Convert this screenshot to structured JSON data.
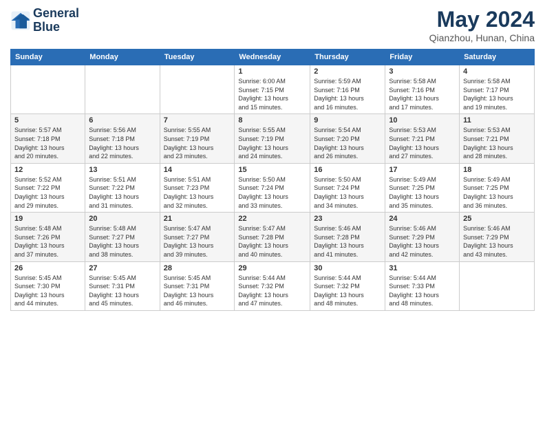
{
  "logo": {
    "line1": "General",
    "line2": "Blue"
  },
  "title": {
    "month_year": "May 2024",
    "location": "Qianzhou, Hunan, China"
  },
  "days_of_week": [
    "Sunday",
    "Monday",
    "Tuesday",
    "Wednesday",
    "Thursday",
    "Friday",
    "Saturday"
  ],
  "weeks": [
    [
      {
        "day": "",
        "info": ""
      },
      {
        "day": "",
        "info": ""
      },
      {
        "day": "",
        "info": ""
      },
      {
        "day": "1",
        "info": "Sunrise: 6:00 AM\nSunset: 7:15 PM\nDaylight: 13 hours\nand 15 minutes."
      },
      {
        "day": "2",
        "info": "Sunrise: 5:59 AM\nSunset: 7:16 PM\nDaylight: 13 hours\nand 16 minutes."
      },
      {
        "day": "3",
        "info": "Sunrise: 5:58 AM\nSunset: 7:16 PM\nDaylight: 13 hours\nand 17 minutes."
      },
      {
        "day": "4",
        "info": "Sunrise: 5:58 AM\nSunset: 7:17 PM\nDaylight: 13 hours\nand 19 minutes."
      }
    ],
    [
      {
        "day": "5",
        "info": "Sunrise: 5:57 AM\nSunset: 7:18 PM\nDaylight: 13 hours\nand 20 minutes."
      },
      {
        "day": "6",
        "info": "Sunrise: 5:56 AM\nSunset: 7:18 PM\nDaylight: 13 hours\nand 22 minutes."
      },
      {
        "day": "7",
        "info": "Sunrise: 5:55 AM\nSunset: 7:19 PM\nDaylight: 13 hours\nand 23 minutes."
      },
      {
        "day": "8",
        "info": "Sunrise: 5:55 AM\nSunset: 7:19 PM\nDaylight: 13 hours\nand 24 minutes."
      },
      {
        "day": "9",
        "info": "Sunrise: 5:54 AM\nSunset: 7:20 PM\nDaylight: 13 hours\nand 26 minutes."
      },
      {
        "day": "10",
        "info": "Sunrise: 5:53 AM\nSunset: 7:21 PM\nDaylight: 13 hours\nand 27 minutes."
      },
      {
        "day": "11",
        "info": "Sunrise: 5:53 AM\nSunset: 7:21 PM\nDaylight: 13 hours\nand 28 minutes."
      }
    ],
    [
      {
        "day": "12",
        "info": "Sunrise: 5:52 AM\nSunset: 7:22 PM\nDaylight: 13 hours\nand 29 minutes."
      },
      {
        "day": "13",
        "info": "Sunrise: 5:51 AM\nSunset: 7:22 PM\nDaylight: 13 hours\nand 31 minutes."
      },
      {
        "day": "14",
        "info": "Sunrise: 5:51 AM\nSunset: 7:23 PM\nDaylight: 13 hours\nand 32 minutes."
      },
      {
        "day": "15",
        "info": "Sunrise: 5:50 AM\nSunset: 7:24 PM\nDaylight: 13 hours\nand 33 minutes."
      },
      {
        "day": "16",
        "info": "Sunrise: 5:50 AM\nSunset: 7:24 PM\nDaylight: 13 hours\nand 34 minutes."
      },
      {
        "day": "17",
        "info": "Sunrise: 5:49 AM\nSunset: 7:25 PM\nDaylight: 13 hours\nand 35 minutes."
      },
      {
        "day": "18",
        "info": "Sunrise: 5:49 AM\nSunset: 7:25 PM\nDaylight: 13 hours\nand 36 minutes."
      }
    ],
    [
      {
        "day": "19",
        "info": "Sunrise: 5:48 AM\nSunset: 7:26 PM\nDaylight: 13 hours\nand 37 minutes."
      },
      {
        "day": "20",
        "info": "Sunrise: 5:48 AM\nSunset: 7:27 PM\nDaylight: 13 hours\nand 38 minutes."
      },
      {
        "day": "21",
        "info": "Sunrise: 5:47 AM\nSunset: 7:27 PM\nDaylight: 13 hours\nand 39 minutes."
      },
      {
        "day": "22",
        "info": "Sunrise: 5:47 AM\nSunset: 7:28 PM\nDaylight: 13 hours\nand 40 minutes."
      },
      {
        "day": "23",
        "info": "Sunrise: 5:46 AM\nSunset: 7:28 PM\nDaylight: 13 hours\nand 41 minutes."
      },
      {
        "day": "24",
        "info": "Sunrise: 5:46 AM\nSunset: 7:29 PM\nDaylight: 13 hours\nand 42 minutes."
      },
      {
        "day": "25",
        "info": "Sunrise: 5:46 AM\nSunset: 7:29 PM\nDaylight: 13 hours\nand 43 minutes."
      }
    ],
    [
      {
        "day": "26",
        "info": "Sunrise: 5:45 AM\nSunset: 7:30 PM\nDaylight: 13 hours\nand 44 minutes."
      },
      {
        "day": "27",
        "info": "Sunrise: 5:45 AM\nSunset: 7:31 PM\nDaylight: 13 hours\nand 45 minutes."
      },
      {
        "day": "28",
        "info": "Sunrise: 5:45 AM\nSunset: 7:31 PM\nDaylight: 13 hours\nand 46 minutes."
      },
      {
        "day": "29",
        "info": "Sunrise: 5:44 AM\nSunset: 7:32 PM\nDaylight: 13 hours\nand 47 minutes."
      },
      {
        "day": "30",
        "info": "Sunrise: 5:44 AM\nSunset: 7:32 PM\nDaylight: 13 hours\nand 48 minutes."
      },
      {
        "day": "31",
        "info": "Sunrise: 5:44 AM\nSunset: 7:33 PM\nDaylight: 13 hours\nand 48 minutes."
      },
      {
        "day": "",
        "info": ""
      }
    ]
  ]
}
